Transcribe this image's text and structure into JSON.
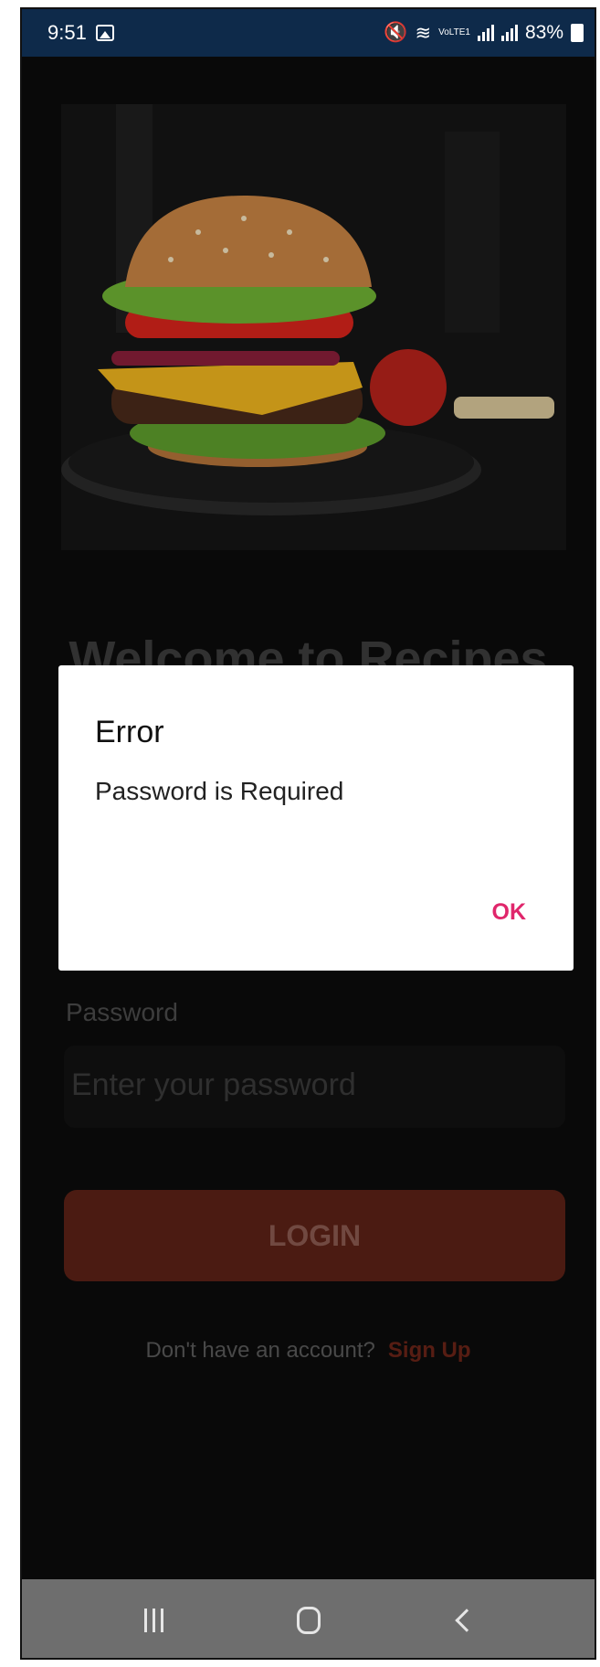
{
  "status_bar": {
    "time": "9:51",
    "lte_tag": "VoLTE1",
    "battery": "83%"
  },
  "hero": {
    "image": "burger-photo"
  },
  "welcome_heading": "Welcome to Recipes",
  "password": {
    "label": "Password",
    "placeholder": "Enter your password"
  },
  "login_button": "LOGIN",
  "signup": {
    "prompt": "Don't have an account?",
    "link": "Sign Up"
  },
  "dialog": {
    "title": "Error",
    "message": "Password is Required",
    "ok_label": "OK"
  },
  "colors": {
    "status_bar": "#0e2a4a",
    "accent": "#e0266b",
    "login_button": "#5c2216"
  }
}
